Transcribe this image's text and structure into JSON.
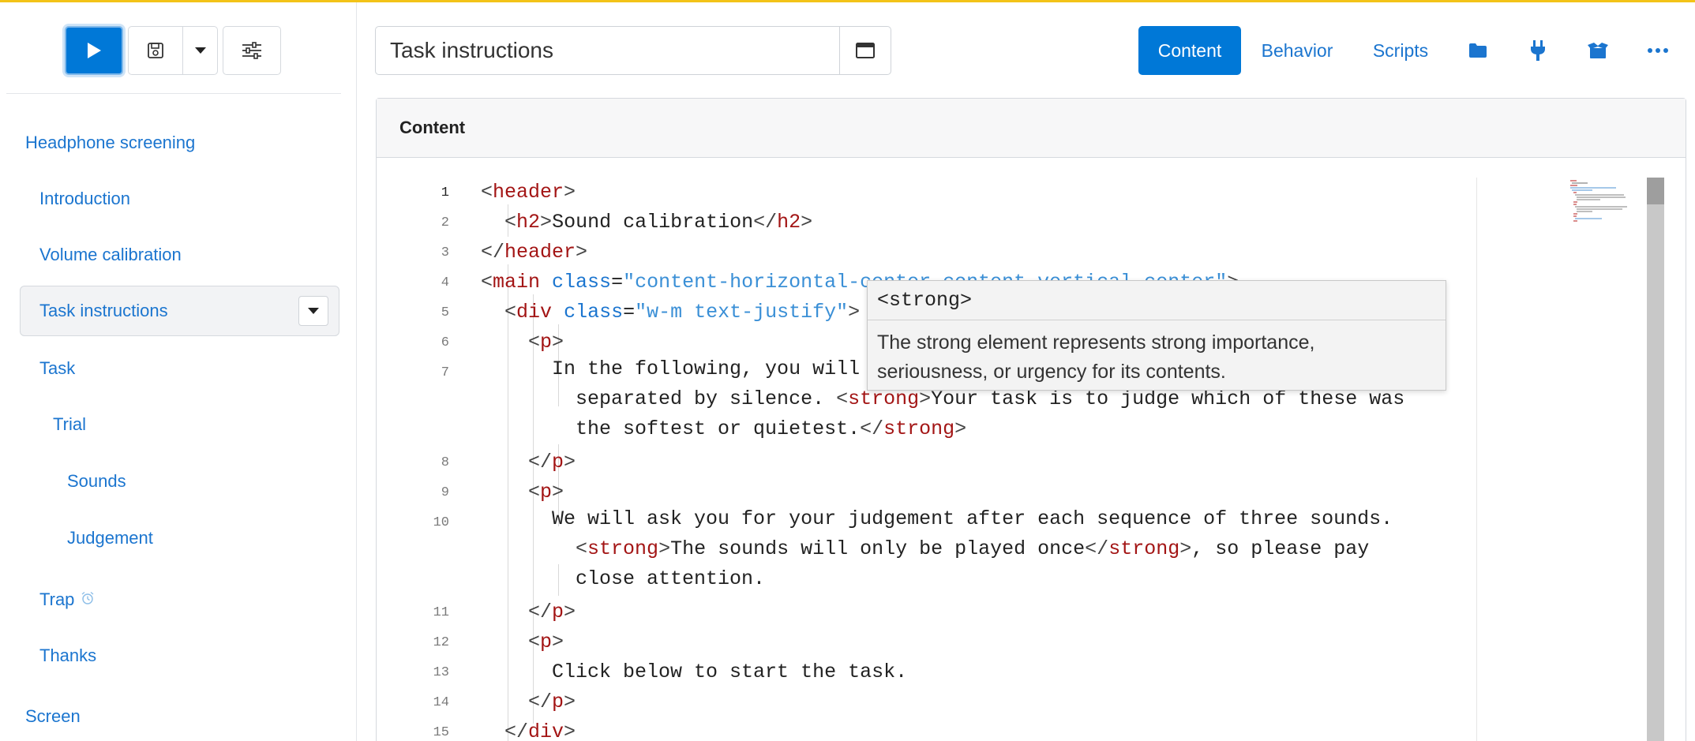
{
  "toolbar": {
    "run_icon": "play-icon",
    "save_icon": "save-icon",
    "save_menu_icon": "caret-down-icon",
    "options_icon": "sliders-icon"
  },
  "sidebar": {
    "items": [
      {
        "label": "Headphone screening",
        "level": 0
      },
      {
        "label": "Introduction",
        "level": 1
      },
      {
        "label": "Volume calibration",
        "level": 1
      },
      {
        "label": "Task instructions",
        "level": 1,
        "selected": true
      },
      {
        "label": "Task",
        "level": 1
      },
      {
        "label": "Trial",
        "level": 2
      },
      {
        "label": "Sounds",
        "level": 3
      },
      {
        "label": "Judgement",
        "level": 3
      },
      {
        "label": "Trap",
        "level": 1,
        "icon": "alarm-clock-icon"
      },
      {
        "label": "Thanks",
        "level": 1
      },
      {
        "label": "Screen",
        "level": 0
      }
    ]
  },
  "header": {
    "title_value": "Task instructions",
    "title_window_icon": "window-icon",
    "tabs": [
      {
        "label": "Content",
        "active": true
      },
      {
        "label": "Behavior"
      },
      {
        "label": "Scripts"
      }
    ],
    "icon_tabs": [
      "folder-icon",
      "plug-icon",
      "package-icon",
      "more-icon"
    ]
  },
  "panel": {
    "heading": "Content"
  },
  "editor": {
    "line_numbers": [
      "1",
      "2",
      "3",
      "4",
      "5",
      "6",
      "7",
      "8",
      "9",
      "10",
      "11",
      "12",
      "13",
      "14",
      "15"
    ],
    "current_line": "1"
  },
  "tooltip": {
    "tag": "<strong>",
    "description_line1": "The strong element represents strong importance,",
    "description_line2": "seriousness, or urgency for its contents."
  },
  "colors": {
    "accent": "#0078d7",
    "link": "#1b75cf",
    "top_border": "#f3c318",
    "tag": "#a31515",
    "attribute": "#1b75cf",
    "string": "#3a8fd6"
  }
}
